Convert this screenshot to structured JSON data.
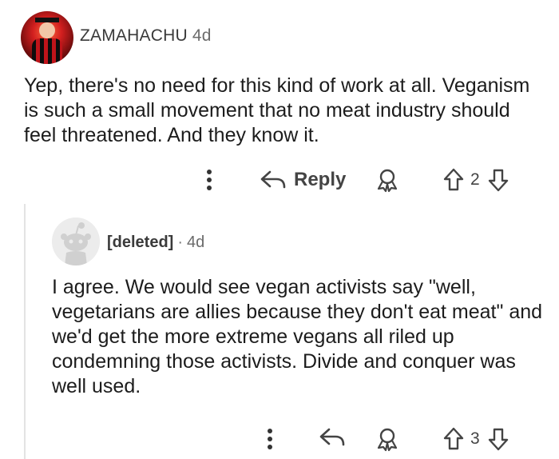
{
  "comment": {
    "username": "ZAMAHACHU",
    "time": "4d",
    "body": "Yep, there's no need for this kind of work at all. Veganism is such a small movement that no meat industry should feel threatened. And they know it.",
    "actions": {
      "more_icon": "more-vertical-icon",
      "reply_icon": "reply-arrow-icon",
      "reply_label": "Reply",
      "award_icon": "award-icon",
      "upvote_icon": "upvote-arrow-icon",
      "score": "2",
      "downvote_icon": "downvote-arrow-icon"
    }
  },
  "reply": {
    "username": "[deleted]",
    "separator": "·",
    "time": "4d",
    "body": "I agree. We would see vegan activists say \"well, vegetarians are allies because they don't eat meat\" and we'd get the more extreme vegans all riled up condemning those activists. Divide and conquer was well used.",
    "actions": {
      "more_icon": "more-vertical-icon",
      "reply_icon": "reply-arrow-icon",
      "award_icon": "award-icon",
      "upvote_icon": "upvote-arrow-icon",
      "score": "3",
      "downvote_icon": "downvote-arrow-icon"
    }
  },
  "colors": {
    "text": "#1c1c1c",
    "meta": "#6b6b6b",
    "thread_line": "#e3e3e3"
  }
}
